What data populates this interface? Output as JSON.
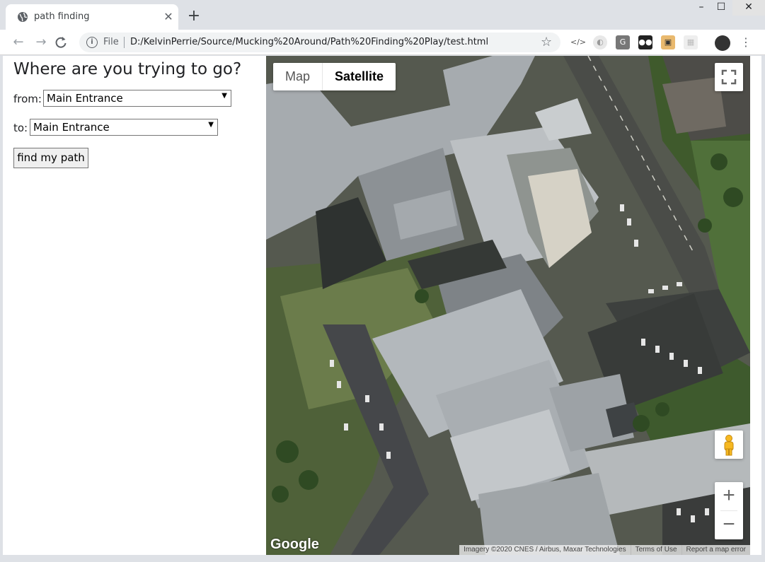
{
  "browser": {
    "tab_title": "path finding",
    "tab_close": "✕",
    "new_tab": "+",
    "file_label": "File",
    "url": "D:/KelvinPerrie/Source/Mucking%20Around/Path%20Finding%20Play/test.html",
    "window_minimize": "–",
    "window_maximize": "☐",
    "window_close": "✕",
    "extensions": [
      "code-brackets-icon",
      "half-circle-icon",
      "G",
      "paw-icon",
      "cat-icon",
      "grid-icon"
    ],
    "extension_g": "G"
  },
  "form": {
    "heading": "Where are you trying to go?",
    "from_label": "from:",
    "from_value": "Main Entrance",
    "to_label": "to:",
    "to_value": "Main Entrance",
    "submit_label": "find my path"
  },
  "map": {
    "type_map": "Map",
    "type_satellite": "Satellite",
    "selected_type": "Satellite",
    "zoom_in": "+",
    "zoom_out": "−",
    "logo": "Google",
    "imagery": "Imagery ©2020 CNES / Airbus, Maxar Technologies",
    "terms": "Terms of Use",
    "report": "Report a map error"
  },
  "colors": {
    "tab_strip": "#dee1e6",
    "roof": "#b9bec3",
    "grass": "#5f7048",
    "road": "#4d504c"
  }
}
